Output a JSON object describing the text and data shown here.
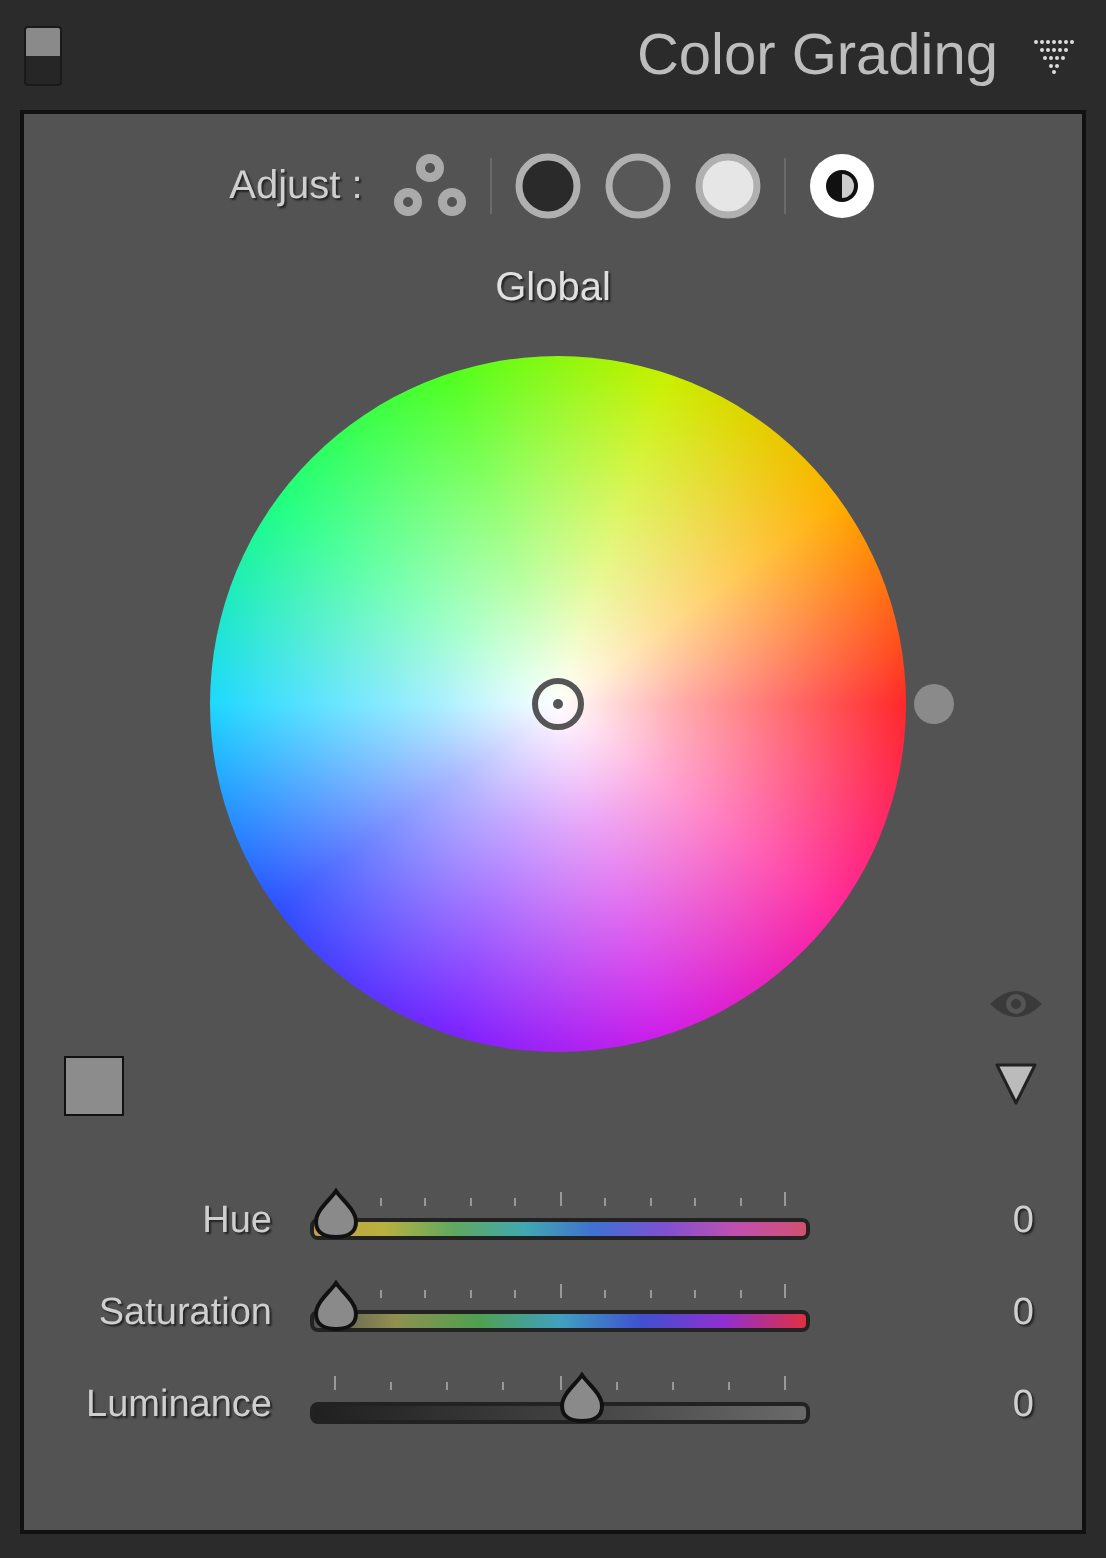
{
  "header": {
    "title": "Color Grading"
  },
  "adjust": {
    "label": "Adjust :",
    "modes": [
      {
        "kind": "three-way",
        "selected": false
      },
      {
        "kind": "shadows",
        "selected": false
      },
      {
        "kind": "midtones",
        "selected": false
      },
      {
        "kind": "highlights",
        "selected": false
      },
      {
        "kind": "global",
        "selected": true
      }
    ]
  },
  "wheel": {
    "title": "Global"
  },
  "sliders": [
    {
      "kind": "hue",
      "label": "Hue",
      "level": 0,
      "reading": "0"
    },
    {
      "kind": "saturation",
      "label": "Saturation",
      "level": 0,
      "reading": "0"
    },
    {
      "kind": "luminance",
      "label": "Luminance",
      "level": 0.5,
      "reading": "0"
    }
  ]
}
